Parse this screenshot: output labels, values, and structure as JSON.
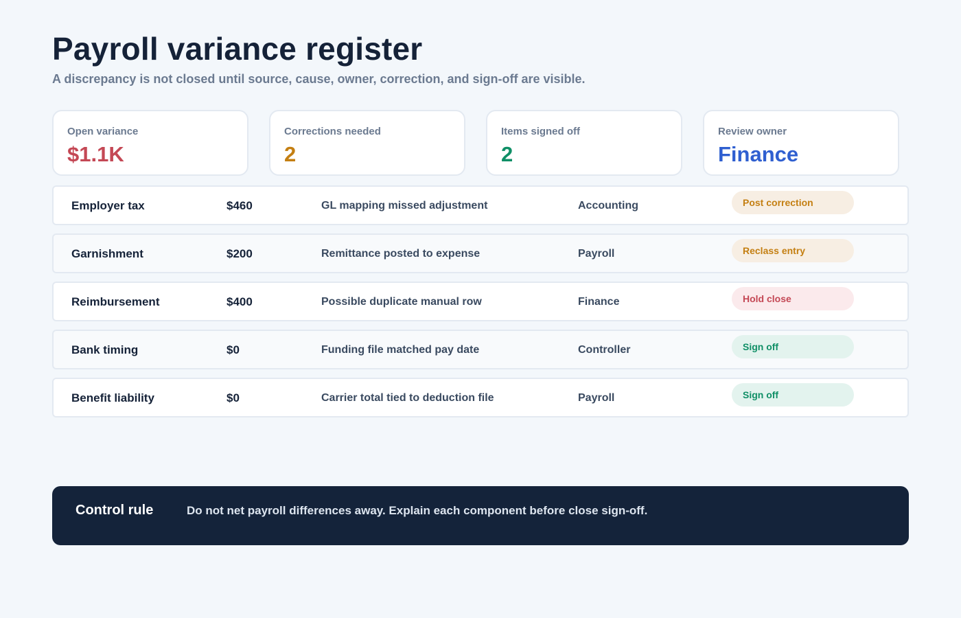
{
  "header": {
    "title": "Payroll variance register",
    "subtitle": "A discrepancy is not closed until source, cause, owner, correction, and sign-off are visible."
  },
  "stats": [
    {
      "label": "Open variance",
      "value": "$1.1K",
      "color": "#c44855"
    },
    {
      "label": "Corrections needed",
      "value": "2",
      "color": "#c47f12"
    },
    {
      "label": "Items signed off",
      "value": "2",
      "color": "#0f8f66"
    },
    {
      "label": "Review owner",
      "value": "Finance",
      "color": "#2f5fd0"
    }
  ],
  "rows": [
    {
      "category": "Employer tax",
      "amount": "$460",
      "cause": "GL mapping missed adjustment",
      "owner": "Accounting",
      "action": "Post correction",
      "status": "amber"
    },
    {
      "category": "Garnishment",
      "amount": "$200",
      "cause": "Remittance posted to expense",
      "owner": "Payroll",
      "action": "Reclass entry",
      "status": "amber"
    },
    {
      "category": "Reimbursement",
      "amount": "$400",
      "cause": "Possible duplicate manual row",
      "owner": "Finance",
      "action": "Hold close",
      "status": "red"
    },
    {
      "category": "Bank timing",
      "amount": "$0",
      "cause": "Funding file matched pay date",
      "owner": "Controller",
      "action": "Sign off",
      "status": "green"
    },
    {
      "category": "Benefit liability",
      "amount": "$0",
      "cause": "Carrier total tied to deduction file",
      "owner": "Payroll",
      "action": "Sign off",
      "status": "green"
    }
  ],
  "control": {
    "title": "Control rule",
    "text": "Do not net payroll differences away. Explain each component before close sign-off."
  }
}
